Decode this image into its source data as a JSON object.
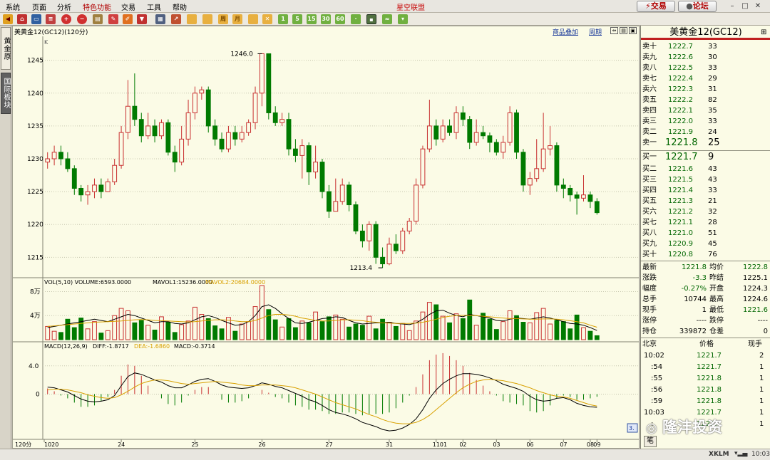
{
  "menubar": {
    "items": [
      "系统",
      "页面",
      "分析",
      "特色功能",
      "交易",
      "工具",
      "帮助"
    ],
    "title": "星空联盟",
    "trade_button": "交易",
    "forum_button": "论坛"
  },
  "toolbar": {
    "period_buttons": [
      "周",
      "月",
      "1",
      "5",
      "15",
      "30",
      "60"
    ]
  },
  "left_tabs": {
    "tab1": "黄金原",
    "tab2": "国际板块"
  },
  "chart": {
    "title": "美黄金12(GC12)(120分)",
    "link_overlay": "商品叠加",
    "link_period": "周期",
    "kline_label": "K",
    "high_label": "1246.0",
    "low_label": "1213.4",
    "price_ticks": [
      "1245",
      "1240",
      "1235",
      "1230",
      "1225",
      "1220",
      "1215"
    ],
    "vol_legend": {
      "vol": "VOL(5,10) VOLUME:6593.0000",
      "mavol1": "MAVOL1:15236.0000",
      "mavol2": "MAVOL2:20684.0000"
    },
    "vol_ticks": [
      "8万",
      "4万"
    ],
    "macd_legend": {
      "name": "MACD(12,26,9)",
      "diff": "DIFF:-1.8717",
      "dea": "DEA:-1.6860",
      "macd": "MACD:-0.3714"
    },
    "macd_ticks": [
      "4.0",
      "0"
    ],
    "period_label": "120分",
    "date_labels": [
      "1020",
      "24",
      "25",
      "26",
      "27",
      "31",
      "1101",
      "02",
      "03",
      "06",
      "07",
      "08",
      "09"
    ],
    "side_tag": "3.",
    "colors": {
      "up": "#c83030",
      "down": "#007a00",
      "ma1": "#000000",
      "ma2": "#d8a000",
      "bg": "#fbfbe6"
    }
  },
  "chart_data": [
    {
      "type": "candlestick",
      "title": "美黄金12(GC12)(120分)",
      "ylim": [
        1212,
        1248
      ],
      "high": 1246.0,
      "low": 1213.4,
      "candles": [
        [
          1229.5,
          1230,
          1231,
          1228.5
        ],
        [
          1230,
          1231,
          1232,
          1229
        ],
        [
          1231,
          1230,
          1232,
          1229
        ],
        [
          1230,
          1228.5,
          1231,
          1228
        ],
        [
          1228.5,
          1225.5,
          1229,
          1224.5
        ],
        [
          1225.5,
          1224.5,
          1226,
          1223.5
        ],
        [
          1224.5,
          1225,
          1226,
          1223
        ],
        [
          1225,
          1226,
          1227,
          1224
        ],
        [
          1226,
          1225,
          1227,
          1224
        ],
        [
          1225,
          1226.5,
          1227,
          1225
        ],
        [
          1226.5,
          1229,
          1230,
          1226
        ],
        [
          1229,
          1234,
          1235,
          1228.5
        ],
        [
          1234,
          1238,
          1242,
          1233
        ],
        [
          1238,
          1236,
          1243,
          1235
        ],
        [
          1236,
          1233.5,
          1237,
          1232.5
        ],
        [
          1233.5,
          1235,
          1237,
          1233
        ],
        [
          1235,
          1233.5,
          1236,
          1232.5
        ],
        [
          1233.5,
          1235.5,
          1236,
          1233
        ],
        [
          1235.5,
          1231,
          1236,
          1230.5
        ],
        [
          1231,
          1229.5,
          1232,
          1228
        ],
        [
          1229.5,
          1233,
          1235,
          1229
        ],
        [
          1233,
          1237,
          1239,
          1232
        ],
        [
          1237,
          1240,
          1241,
          1236
        ],
        [
          1240,
          1240.5,
          1241,
          1239
        ],
        [
          1240.5,
          1235,
          1241,
          1234
        ],
        [
          1235,
          1233,
          1236,
          1232
        ],
        [
          1233,
          1231.5,
          1234,
          1231
        ],
        [
          1231.5,
          1234,
          1235,
          1231
        ],
        [
          1234,
          1233,
          1235,
          1232
        ],
        [
          1233,
          1234,
          1235,
          1232.5
        ],
        [
          1234,
          1235.5,
          1236,
          1233.5
        ],
        [
          1235.5,
          1240,
          1241,
          1234.5
        ],
        [
          1240,
          1246,
          1246,
          1238
        ],
        [
          1246,
          1237,
          1246,
          1236
        ],
        [
          1237,
          1235.5,
          1238,
          1235
        ],
        [
          1235.5,
          1236,
          1237,
          1235
        ],
        [
          1236,
          1231.5,
          1237,
          1230.5
        ],
        [
          1231.5,
          1230.5,
          1233,
          1229.5
        ],
        [
          1230.5,
          1232,
          1233,
          1227
        ],
        [
          1232,
          1228,
          1232.5,
          1226
        ],
        [
          1228,
          1229.5,
          1232,
          1227
        ],
        [
          1229.5,
          1225,
          1230,
          1224
        ],
        [
          1225,
          1222,
          1226,
          1221
        ],
        [
          1222,
          1223.5,
          1227,
          1222
        ],
        [
          1223.5,
          1226,
          1227,
          1223
        ],
        [
          1226,
          1223,
          1226.5,
          1222
        ],
        [
          1223,
          1219,
          1223.5,
          1218.5
        ],
        [
          1219,
          1217.5,
          1220,
          1216.5
        ],
        [
          1217.5,
          1220,
          1220.5,
          1216
        ],
        [
          1220,
          1215,
          1220.5,
          1214
        ],
        [
          1215,
          1214,
          1216.5,
          1213.4
        ],
        [
          1214,
          1217,
          1218,
          1213.8
        ],
        [
          1217,
          1216,
          1218.5,
          1215.5
        ],
        [
          1216,
          1219,
          1219.5,
          1215.5
        ],
        [
          1219,
          1220.5,
          1221,
          1218.5
        ],
        [
          1220.5,
          1226,
          1227,
          1220
        ],
        [
          1226,
          1231.5,
          1232,
          1225.5
        ],
        [
          1231.5,
          1235,
          1239,
          1231
        ],
        [
          1235,
          1233,
          1236,
          1232
        ],
        [
          1233,
          1235,
          1236,
          1232.5
        ],
        [
          1235,
          1234,
          1236,
          1233.5
        ],
        [
          1234,
          1237,
          1238,
          1233
        ],
        [
          1237,
          1236,
          1238,
          1235
        ],
        [
          1236,
          1232.5,
          1236.5,
          1231.5
        ],
        [
          1232.5,
          1234,
          1236,
          1232
        ],
        [
          1234,
          1233.5,
          1235,
          1233
        ],
        [
          1233.5,
          1232.5,
          1234,
          1231
        ],
        [
          1232.5,
          1231,
          1233,
          1230.5
        ],
        [
          1231,
          1232.5,
          1233.5,
          1230
        ],
        [
          1232.5,
          1237,
          1238,
          1232
        ],
        [
          1237,
          1231,
          1237.5,
          1230
        ],
        [
          1231,
          1226,
          1231.5,
          1225
        ],
        [
          1226,
          1227,
          1228,
          1224.5
        ],
        [
          1227,
          1228.5,
          1233,
          1226.5
        ],
        [
          1228.5,
          1231.5,
          1237,
          1228
        ],
        [
          1231.5,
          1232,
          1235,
          1230.5
        ],
        [
          1232,
          1226,
          1232.5,
          1225
        ],
        [
          1226,
          1225.5,
          1227,
          1224
        ],
        [
          1225.5,
          1224.5,
          1226,
          1223.5
        ],
        [
          1224.5,
          1224,
          1225,
          1221.5
        ],
        [
          1224,
          1224.5,
          1227.5,
          1223.5
        ],
        [
          1224.5,
          1223.5,
          1225,
          1222.5
        ],
        [
          1223.5,
          1221.8,
          1224,
          1221.5
        ]
      ]
    },
    {
      "type": "bar",
      "title": "VOL(5,10)",
      "ylim": [
        0,
        90000
      ],
      "ticks": [
        80000,
        40000
      ],
      "values": [
        22000,
        14000,
        12000,
        34000,
        20000,
        36000,
        18000,
        30000,
        11000,
        15000,
        40000,
        52000,
        48000,
        28000,
        32000,
        24000,
        16000,
        38000,
        29000,
        12000,
        25000,
        31000,
        54000,
        42000,
        35000,
        23000,
        18000,
        37000,
        14000,
        26000,
        30000,
        55000,
        90000,
        50000,
        33000,
        21000,
        35000,
        20000,
        31000,
        28000,
        46000,
        30000,
        38000,
        41000,
        34000,
        21000,
        26000,
        24000,
        39000,
        18000,
        34000,
        29000,
        22000,
        27000,
        15000,
        31000,
        46000,
        62000,
        58000,
        39000,
        28000,
        43000,
        35000,
        66000,
        24000,
        44000,
        34000,
        17000,
        30000,
        48000,
        40000,
        29000,
        28000,
        45000,
        52000,
        26000,
        32000,
        30000,
        18000,
        41000,
        20000,
        14000,
        6593
      ],
      "mavol1": [
        20000,
        22000,
        24000,
        26000,
        28000,
        30000,
        32000,
        34000,
        32000,
        30000,
        34000,
        38000,
        42000,
        40000,
        36000,
        32000,
        28000,
        30000,
        30000,
        27000,
        26000,
        28000,
        33000,
        38000,
        40000,
        37000,
        32000,
        28000,
        24000,
        25000,
        30000,
        40000,
        55000,
        58000,
        52000,
        43000,
        35000,
        28000,
        27000,
        29000,
        32000,
        35000,
        36000,
        38000,
        37000,
        32000,
        28000,
        26000,
        27000,
        28000,
        28000,
        29000,
        27000,
        26000,
        25000,
        28000,
        34000,
        42000,
        48000,
        49000,
        44000,
        40000,
        38000,
        42000,
        40000,
        38000,
        36000,
        32000,
        31000,
        34000,
        36000,
        35000,
        34000,
        36000,
        38000,
        36000,
        33000,
        30000,
        27000,
        26000,
        24000,
        20000,
        15236
      ],
      "mavol2": [
        22000,
        23000,
        24000,
        25000,
        26000,
        27000,
        28000,
        29000,
        29500,
        30000,
        30500,
        31000,
        32000,
        33000,
        33500,
        33000,
        32000,
        31500,
        31000,
        30500,
        30000,
        29500,
        30000,
        31000,
        32000,
        33000,
        33000,
        32500,
        31000,
        30000,
        30000,
        32000,
        36000,
        40000,
        42000,
        42000,
        41000,
        39000,
        36000,
        34000,
        32000,
        31000,
        31000,
        32000,
        33000,
        33000,
        32500,
        31500,
        30000,
        29000,
        28000,
        27500,
        27000,
        27000,
        27000,
        27500,
        29000,
        31000,
        34000,
        37000,
        39000,
        40000,
        40500,
        40500,
        40000,
        39000,
        38000,
        37000,
        36000,
        35000,
        35000,
        34500,
        34000,
        34000,
        34500,
        34500,
        34000,
        33000,
        31500,
        30000,
        28000,
        24000,
        20684
      ]
    },
    {
      "type": "line",
      "title": "MACD(12,26,9)",
      "ylim": [
        -6,
        6.5
      ],
      "ticks": [
        4.0,
        0
      ],
      "diff": [
        1.0,
        0.9,
        0.6,
        0.3,
        -0.2,
        -0.7,
        -1.0,
        -1.1,
        -1.0,
        -0.8,
        -0.2,
        1.2,
        2.5,
        3.0,
        2.8,
        2.4,
        2.0,
        1.7,
        1.2,
        0.9,
        0.9,
        1.3,
        1.8,
        2.1,
        2.2,
        1.8,
        1.3,
        1.0,
        0.9,
        0.8,
        0.9,
        1.2,
        1.6,
        1.4,
        1.1,
        0.9,
        0.5,
        0.1,
        -0.3,
        -0.8,
        -1.1,
        -1.6,
        -2.2,
        -2.6,
        -2.8,
        -3.1,
        -3.5,
        -4.0,
        -4.3,
        -4.6,
        -5.0,
        -5.2,
        -5.1,
        -4.8,
        -4.3,
        -3.5,
        -2.2,
        -0.6,
        0.6,
        1.5,
        2.1,
        2.6,
        2.9,
        2.9,
        2.8,
        2.6,
        2.3,
        1.9,
        1.4,
        1.1,
        0.8,
        0.4,
        -0.3,
        -0.8,
        -1.0,
        -0.9,
        -0.6,
        -0.5,
        -0.8,
        -1.3,
        -1.6,
        -1.8,
        -1.87
      ],
      "dea": [
        0.6,
        0.7,
        0.7,
        0.6,
        0.4,
        0.2,
        -0.1,
        -0.3,
        -0.5,
        -0.6,
        -0.5,
        -0.1,
        0.4,
        1.0,
        1.5,
        1.8,
        2.0,
        2.0,
        1.9,
        1.7,
        1.5,
        1.4,
        1.5,
        1.6,
        1.7,
        1.8,
        1.7,
        1.6,
        1.5,
        1.3,
        1.2,
        1.2,
        1.3,
        1.3,
        1.3,
        1.2,
        1.1,
        0.9,
        0.6,
        0.3,
        0.0,
        -0.4,
        -0.8,
        -1.2,
        -1.5,
        -1.8,
        -2.1,
        -2.5,
        -2.9,
        -3.2,
        -3.6,
        -3.9,
        -4.1,
        -4.2,
        -4.2,
        -4.0,
        -3.6,
        -3.0,
        -2.2,
        -1.4,
        -0.6,
        0.2,
        0.9,
        1.4,
        1.8,
        2.0,
        2.1,
        2.0,
        1.9,
        1.7,
        1.5,
        1.2,
        0.9,
        0.5,
        0.2,
        -0.1,
        -0.3,
        -0.4,
        -0.6,
        -0.9,
        -1.2,
        -1.5,
        -1.686
      ]
    }
  ],
  "quote": {
    "title": "美黄金12(GC12)",
    "asks": [
      {
        "label": "卖十",
        "price": "1222.7",
        "vol": "33"
      },
      {
        "label": "卖九",
        "price": "1222.6",
        "vol": "30"
      },
      {
        "label": "卖八",
        "price": "1222.5",
        "vol": "33"
      },
      {
        "label": "卖七",
        "price": "1222.4",
        "vol": "29"
      },
      {
        "label": "卖六",
        "price": "1222.3",
        "vol": "31"
      },
      {
        "label": "卖五",
        "price": "1222.2",
        "vol": "82"
      },
      {
        "label": "卖四",
        "price": "1222.1",
        "vol": "35"
      },
      {
        "label": "卖三",
        "price": "1222.0",
        "vol": "33"
      },
      {
        "label": "卖二",
        "price": "1221.9",
        "vol": "24"
      },
      {
        "label": "卖一",
        "price": "1221.8",
        "vol": "25"
      }
    ],
    "bids": [
      {
        "label": "买一",
        "price": "1221.7",
        "vol": "9"
      },
      {
        "label": "买二",
        "price": "1221.6",
        "vol": "43"
      },
      {
        "label": "买三",
        "price": "1221.5",
        "vol": "43"
      },
      {
        "label": "买四",
        "price": "1221.4",
        "vol": "33"
      },
      {
        "label": "买五",
        "price": "1221.3",
        "vol": "21"
      },
      {
        "label": "买六",
        "price": "1221.2",
        "vol": "32"
      },
      {
        "label": "买七",
        "price": "1221.1",
        "vol": "28"
      },
      {
        "label": "买八",
        "price": "1221.0",
        "vol": "51"
      },
      {
        "label": "买九",
        "price": "1220.9",
        "vol": "45"
      },
      {
        "label": "买十",
        "price": "1220.8",
        "vol": "76"
      }
    ],
    "stats": [
      {
        "l1": "最新",
        "v1": "1221.8",
        "l2": "均价",
        "v2": "1222.8"
      },
      {
        "l1": "涨跌",
        "v1": "-3.3",
        "l2": "昨结",
        "v2": "1225.1"
      },
      {
        "l1": "幅度",
        "v1": "-0.27%",
        "l2": "开盘",
        "v2": "1224.3"
      },
      {
        "l1": "总手",
        "v1": "10744",
        "l2": "最高",
        "v2": "1224.6"
      },
      {
        "l1": "现手",
        "v1": "1",
        "l2": "最低",
        "v2": "1221.6"
      },
      {
        "l1": "涨停",
        "v1": "----",
        "l2": "跌停",
        "v2": "----"
      },
      {
        "l1": "持仓",
        "v1": "339872",
        "l2": "仓差",
        "v2": "0"
      }
    ],
    "trades_header": {
      "c1": "北京",
      "c2": "价格",
      "c3": "现手"
    },
    "trades": [
      {
        "t": "10:02",
        "p": "1221.7",
        "v": "2"
      },
      {
        "t": ":54",
        "p": "1221.7",
        "v": "1"
      },
      {
        "t": ":55",
        "p": "1221.8",
        "v": "1"
      },
      {
        "t": ":56",
        "p": "1221.8",
        "v": "1"
      },
      {
        "t": ":59",
        "p": "1221.8",
        "v": "1"
      },
      {
        "t": "10:03",
        "p": "1221.7",
        "v": "1"
      },
      {
        "t": ":",
        "p": "1221.7",
        "v": "1"
      }
    ],
    "tab_label": "笔"
  },
  "status": {
    "brand": "XKLM",
    "time": "10:03"
  },
  "watermark": "隆沣投资"
}
